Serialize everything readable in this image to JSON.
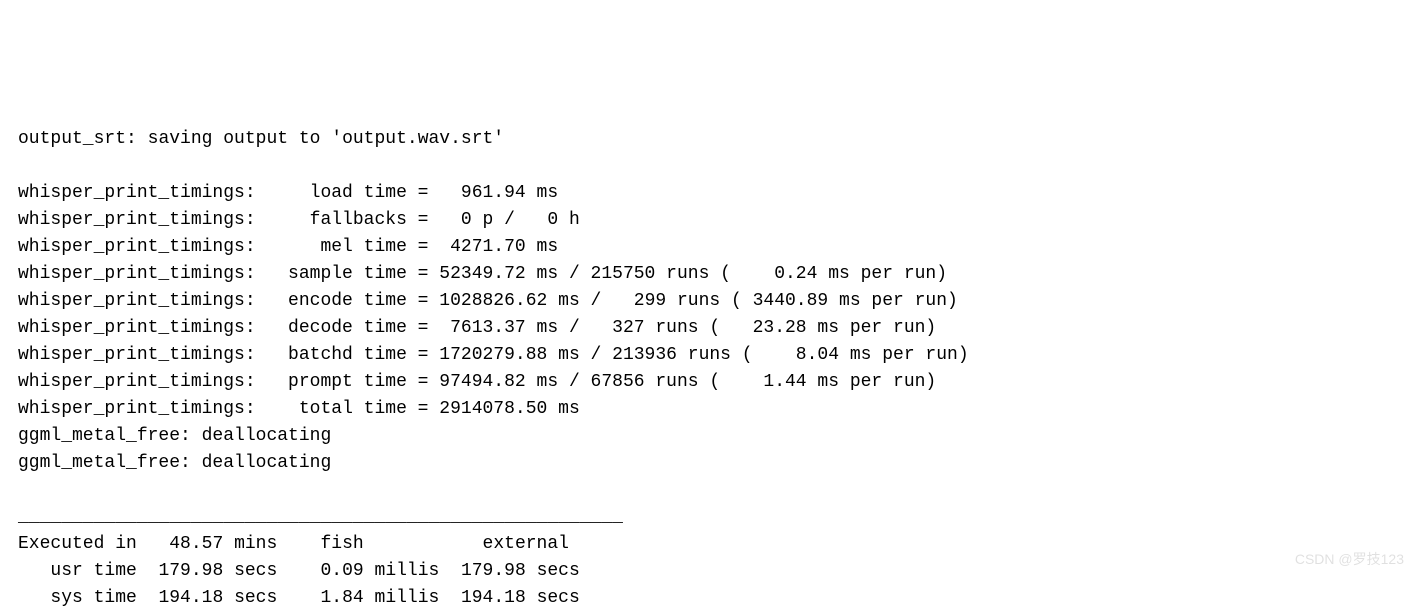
{
  "output_srt": {
    "prefix": "output_srt:",
    "message": "saving output to",
    "filename": "'output.wav.srt'"
  },
  "timings": {
    "prefix": "whisper_print_timings:",
    "load": {
      "label": "load time =",
      "value": "961.94",
      "unit": "ms"
    },
    "fallbacks": {
      "label": "fallbacks =",
      "p": "0",
      "h": "0"
    },
    "mel": {
      "label": "mel time =",
      "value": "4271.70",
      "unit": "ms"
    },
    "sample": {
      "label": "sample time =",
      "value": "52349.72",
      "unit": "ms",
      "runs": "215750",
      "per_run": "0.24"
    },
    "encode": {
      "label": "encode time =",
      "value": "1028826.62",
      "unit": "ms",
      "runs": "299",
      "per_run": "3440.89"
    },
    "decode": {
      "label": "decode time =",
      "value": "7613.37",
      "unit": "ms",
      "runs": "327",
      "per_run": "23.28"
    },
    "batchd": {
      "label": "batchd time =",
      "value": "1720279.88",
      "unit": "ms",
      "runs": "213936",
      "per_run": "8.04"
    },
    "prompt": {
      "label": "prompt time =",
      "value": "97494.82",
      "unit": "ms",
      "runs": "67856",
      "per_run": "1.44"
    },
    "total": {
      "label": "total time =",
      "value": "2914078.50",
      "unit": "ms"
    }
  },
  "ggml": {
    "line1": "ggml_metal_free: deallocating",
    "line2": "ggml_metal_free: deallocating"
  },
  "separator": "________________________________________________________",
  "exec": {
    "header": {
      "label": "Executed in",
      "value": "48.57",
      "unit": "mins",
      "col1": "fish",
      "col2": "external"
    },
    "usr": {
      "label": "usr time",
      "value": "179.98",
      "unit": "secs",
      "fish_val": "0.09",
      "fish_unit": "millis",
      "ext_val": "179.98",
      "ext_unit": "secs"
    },
    "sys": {
      "label": "sys time",
      "value": "194.18",
      "unit": "secs",
      "fish_val": "1.84",
      "fish_unit": "millis",
      "ext_val": "194.18",
      "ext_unit": "secs"
    }
  },
  "watermark": "CSDN @罗技123"
}
